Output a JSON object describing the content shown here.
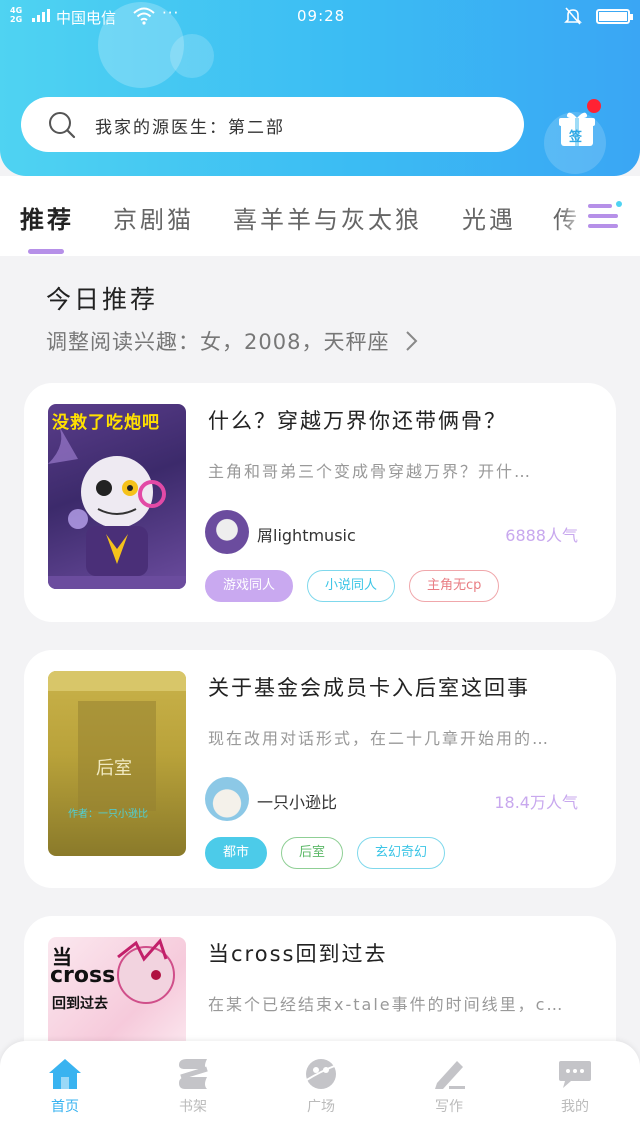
{
  "status_bar": {
    "network": "4G\n2G",
    "carrier": "中国电信",
    "dots": "···",
    "time": "09:28"
  },
  "search": {
    "text": "我家的源医生：第二部"
  },
  "tabs": [
    {
      "label": "推荐",
      "active": true
    },
    {
      "label": "京剧猫",
      "active": false
    },
    {
      "label": "喜羊羊与灰太狼",
      "active": false
    },
    {
      "label": "光遇",
      "active": false
    },
    {
      "label": "传",
      "active": false
    }
  ],
  "section": {
    "title": "今日推荐",
    "subtitle": "调整阅读兴趣：女，2008，天秤座"
  },
  "books": [
    {
      "cover_text": "没救了吃炮吧",
      "title": "什么？穿越万界你还带俩骨？",
      "desc": "主角和哥弟三个变成骨穿越万界？开什…",
      "author": "屑lightmusic",
      "popularity": "6888人气",
      "tags": [
        {
          "label": "游戏同人",
          "style": "purple"
        },
        {
          "label": "小说同人",
          "style": "cyan"
        },
        {
          "label": "主角无cp",
          "style": "red"
        }
      ]
    },
    {
      "cover_text": "后室",
      "cover_author": "作者：一只小逊比",
      "title": "关于基金会成员卡入后室这回事",
      "desc": "现在改用对话形式，在二十几章开始用的…",
      "author": "一只小逊比",
      "popularity": "18.4万人气",
      "tags": [
        {
          "label": "都市",
          "style": "blue-fill"
        },
        {
          "label": "后室",
          "style": "green"
        },
        {
          "label": "玄幻奇幻",
          "style": "cyan"
        }
      ]
    },
    {
      "cover_text_top": "当",
      "cover_text_mid": "cross",
      "cover_text_bot": "回到过去",
      "title": "当cross回到过去",
      "desc": "在某个已经结束x-tale事件的时间线里，c…"
    }
  ],
  "gift": {
    "label": "签"
  },
  "bottom_nav": [
    {
      "label": "首页",
      "icon": "home-icon",
      "active": true
    },
    {
      "label": "书架",
      "icon": "bookshelf-icon",
      "active": false
    },
    {
      "label": "广场",
      "icon": "plaza-icon",
      "active": false
    },
    {
      "label": "写作",
      "icon": "write-icon",
      "active": false
    },
    {
      "label": "我的",
      "icon": "message-icon",
      "active": false
    }
  ],
  "colors": {
    "header_gradient_start": "#4fd3f2",
    "header_gradient_end": "#3aa6f4",
    "accent_purple": "#b690e8",
    "active_nav": "#39b3f0"
  }
}
